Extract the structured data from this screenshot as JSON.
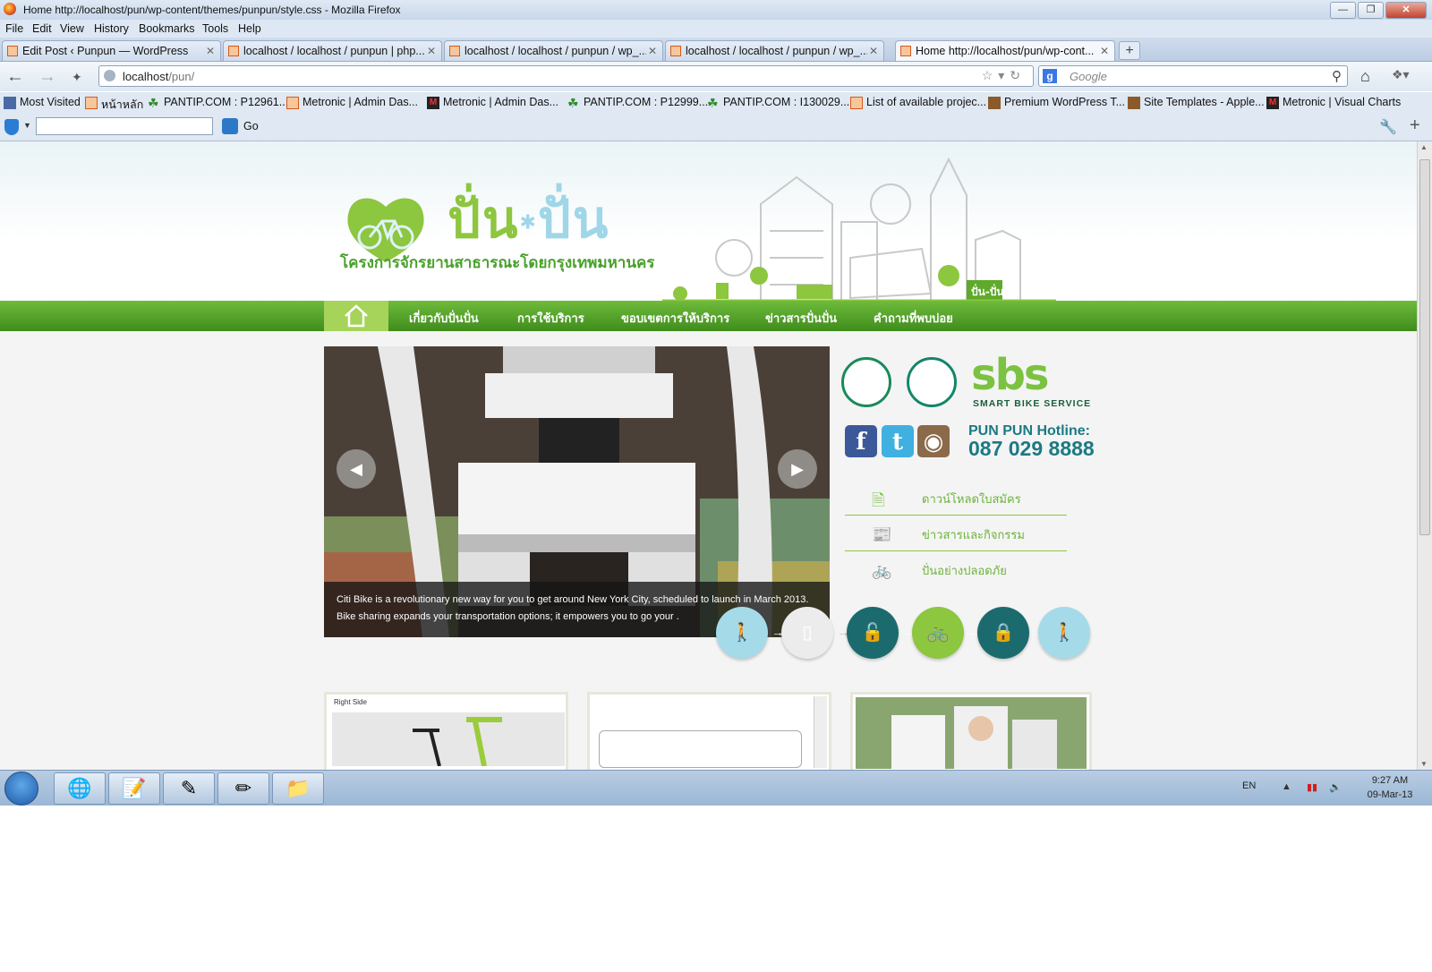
{
  "window": {
    "title": "Home http://localhost/pun/wp-content/themes/punpun/style.css - Mozilla Firefox"
  },
  "menubar": [
    "File",
    "Edit",
    "View",
    "History",
    "Bookmarks",
    "Tools",
    "Help"
  ],
  "tabs": [
    {
      "label": "Edit Post ‹ Punpun — WordPress"
    },
    {
      "label": "localhost / localhost / punpun | php..."
    },
    {
      "label": "localhost / localhost / punpun / wp_..."
    },
    {
      "label": "localhost / localhost / punpun / wp_..."
    },
    {
      "label": "Home http://localhost/pun/wp-cont..."
    }
  ],
  "navbar": {
    "url_host": "localhost",
    "url_path": "/pun/",
    "search_placeholder": "Google"
  },
  "bookmarks": [
    {
      "label": "Most Visited",
      "icon": "bookmark-star-icon"
    },
    {
      "label": "หน้าหลัก",
      "icon": "xampp-icon"
    },
    {
      "label": "PANTIP.COM : P12961...",
      "icon": "cactus-icon"
    },
    {
      "label": "Metronic | Admin Das...",
      "icon": "xampp-icon"
    },
    {
      "label": "Metronic | Admin Das...",
      "icon": "metronic-icon"
    },
    {
      "label": "PANTIP.COM : P12999...",
      "icon": "cactus-icon"
    },
    {
      "label": "PANTIP.COM : I130029...",
      "icon": "cactus-icon"
    },
    {
      "label": "List of available projec...",
      "icon": "xampp-icon"
    },
    {
      "label": "Premium WordPress T...",
      "icon": "template-icon"
    },
    {
      "label": "Site Templates - Apple...",
      "icon": "template-icon"
    },
    {
      "label": "Metronic | Visual Charts",
      "icon": "metronic-icon"
    }
  ],
  "toolbar2": {
    "go_label": "Go"
  },
  "site": {
    "brand_part1": "ปั่น",
    "brand_part2": "ปั่น",
    "tagline": "โครงการจักรยานสาธารณะโดยกรุงเทพมหานคร",
    "city_sign": "ปั่น-ปั่น",
    "nav": [
      "เกี่ยวกับปั่นปั่น",
      "การใช้บริการ",
      "ขอบเขตการให้บริการ",
      "ข่าวสารปั่นปั่น",
      "คำถามที่พบบ่อย"
    ],
    "slider": {
      "caption_line1": "Citi Bike is a revolutionary new way for you to get around New York City, scheduled to launch in March 2013.",
      "caption_line2": "Bike sharing expands your transportation options; it empowers you to go your ."
    },
    "sbs_logo": "sbs",
    "sbs_sub": "SMART BIKE SERVICE",
    "hotline_label": "PUN PUN Hotline:",
    "hotline_number": "087 029 8888",
    "side_links": [
      "ดาวน์โหลดใบสมัคร",
      "ข่าวสารและกิจกรรม",
      "ปั่นอย่างปลอดภัย"
    ],
    "card1_label": "Right Side"
  },
  "taskbar": {
    "lang": "EN",
    "time": "9:27 AM",
    "date": "09-Mar-13"
  },
  "colors": {
    "brand_green": "#8dc63f",
    "brand_blue": "#9fd6e8",
    "nav_green": "#4f9e26",
    "teal": "#1b7a83"
  }
}
